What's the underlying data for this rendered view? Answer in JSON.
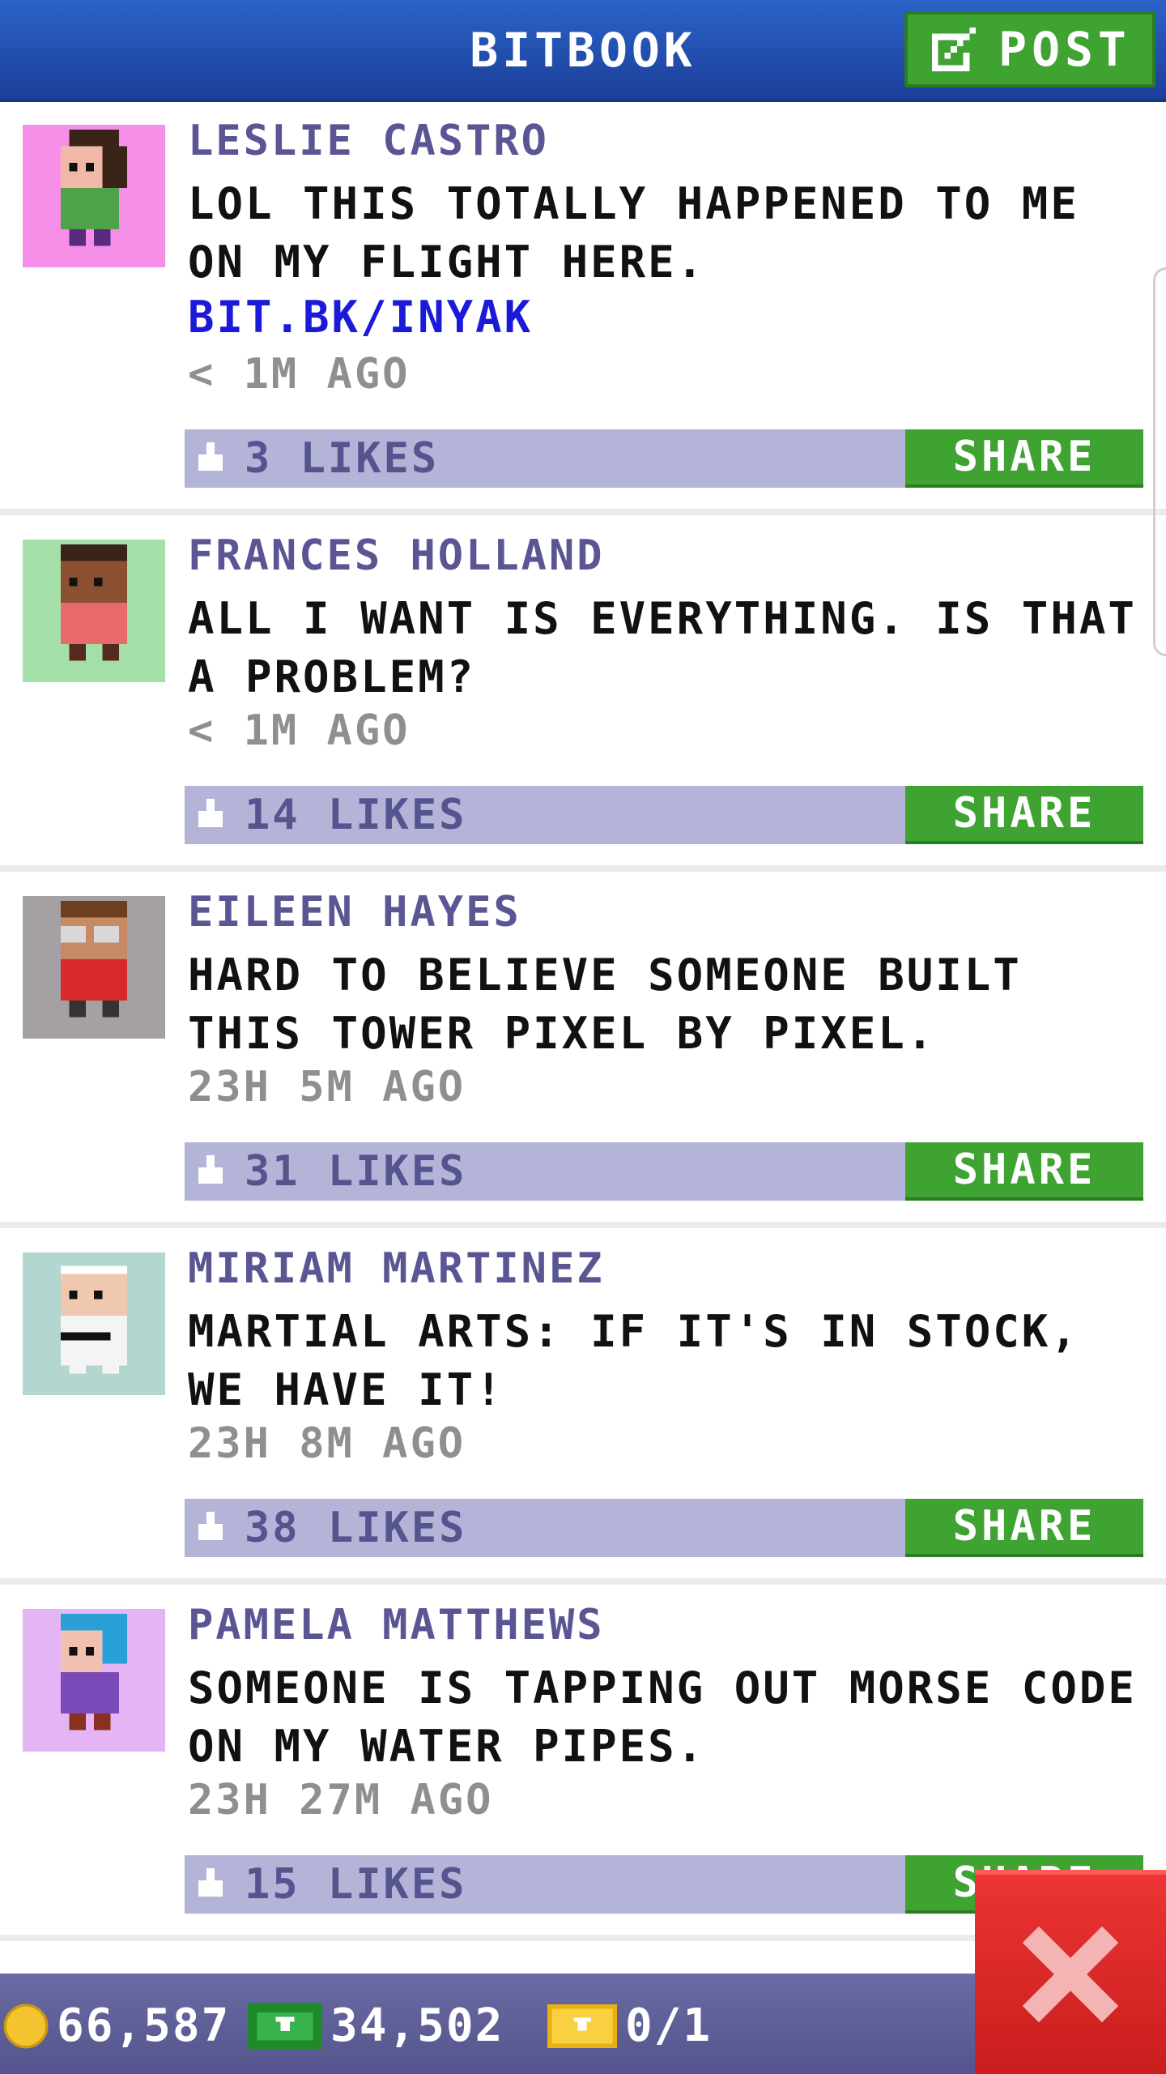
{
  "header": {
    "title": "BITBOOK",
    "post_label": "POST"
  },
  "posts": [
    {
      "author": "LESLIE CASTRO",
      "message": "LOL THIS TOTALLY HAPPENED TO ME ON MY FLIGHT HERE.",
      "link": "BIT.BK/INYAK",
      "time": "< 1M AGO",
      "likes": "3 LIKES",
      "share": "SHARE",
      "avatar_bg": "#f58fe8"
    },
    {
      "author": "FRANCES HOLLAND",
      "message": "ALL I WANT IS EVERYTHING. IS THAT A PROBLEM?",
      "time": "< 1M AGO",
      "likes": "14 LIKES",
      "share": "SHARE",
      "avatar_bg": "#a4dea8"
    },
    {
      "author": "EILEEN HAYES",
      "message": "HARD TO BELIEVE SOMEONE BUILT THIS TOWER PIXEL BY PIXEL.",
      "time": "23H 5M AGO",
      "likes": "31 LIKES",
      "share": "SHARE",
      "avatar_bg": "#a4a0a4"
    },
    {
      "author": "MIRIAM MARTINEZ",
      "message": "MARTIAL ARTS: IF IT'S IN STOCK, WE HAVE IT!",
      "time": "23H 8M AGO",
      "likes": "38 LIKES",
      "share": "SHARE",
      "avatar_bg": "#b4d6d0"
    },
    {
      "author": "PAMELA MATTHEWS",
      "message": "SOMEONE IS TAPPING OUT MORSE CODE ON MY WATER PIPES.",
      "time": "23H 27M AGO",
      "likes": "15 LIKES",
      "share": "SHARE",
      "avatar_bg": "#e4b4f4"
    }
  ],
  "status": {
    "coins": "66,587",
    "bux": "34,502",
    "tickets": "0/1"
  },
  "colors": {
    "header_blue": "#2b63c8",
    "share_green": "#3fa331",
    "likes_bar": "#b4b4d8",
    "author_purple": "#5a5694",
    "close_red": "#e02828"
  },
  "icons": {
    "post": "edit-icon",
    "like": "thumbs-up-icon",
    "coins": "coin-icon",
    "bux": "bux-icon",
    "tickets": "ticket-icon",
    "close": "close-icon"
  }
}
